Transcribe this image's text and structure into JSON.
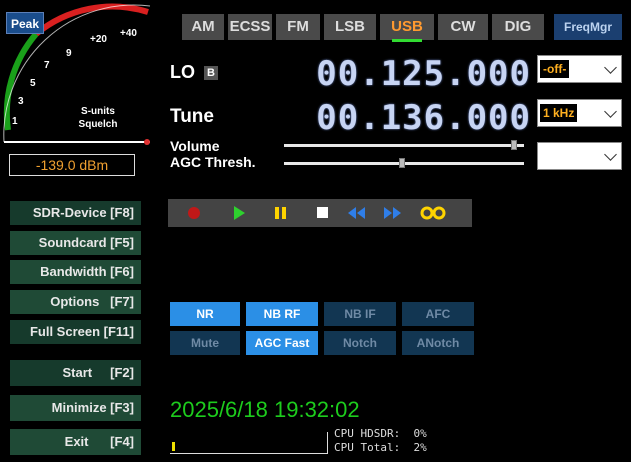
{
  "smeter": {
    "peak_label": "Peak",
    "scale_labels": [
      "1",
      "3",
      "5",
      "7",
      "9",
      "+20",
      "+40"
    ],
    "legend_line1": "S-units",
    "legend_line2": "Squelch",
    "dbm_readout": "-139.0 dBm"
  },
  "modes": [
    {
      "label": "AM",
      "active": false
    },
    {
      "label": "ECSS",
      "active": false
    },
    {
      "label": "FM",
      "active": false
    },
    {
      "label": "LSB",
      "active": false
    },
    {
      "label": "USB",
      "active": true
    },
    {
      "label": "CW",
      "active": false
    },
    {
      "label": "DIG",
      "active": false
    }
  ],
  "freqmgr_label": "FreqMgr",
  "lo": {
    "label": "LO",
    "badge": "B",
    "frequency": "00.125.000",
    "select_value": "-off-"
  },
  "tune": {
    "label": "Tune",
    "frequency": "00.136.000",
    "select_value": "1 kHz"
  },
  "volume": {
    "label": "Volume",
    "level": 0.97
  },
  "agc": {
    "label": "AGC Thresh.",
    "level": 0.49,
    "select_value": ""
  },
  "left_buttons": [
    {
      "label": "SDR-Device [F8]"
    },
    {
      "label": "Soundcard [F5]"
    },
    {
      "label": "Bandwidth [F6]"
    },
    {
      "label": "Options   [F7]"
    },
    {
      "label": "Full Screen [F11]"
    },
    {
      "label": "Start     [F2]"
    },
    {
      "label": "Minimize [F3]"
    },
    {
      "label": "Exit      [F4]"
    }
  ],
  "transport": [
    "record-icon",
    "play-icon",
    "pause-icon",
    "stop-icon",
    "rewind-icon",
    "fast-forward-icon",
    "loop-icon"
  ],
  "dsp_row1": [
    {
      "label": "NR",
      "on": true
    },
    {
      "label": "NB RF",
      "on": true
    },
    {
      "label": "NB IF",
      "on": false
    },
    {
      "label": "AFC",
      "on": false
    }
  ],
  "dsp_row2": [
    {
      "label": "Mute",
      "on": false
    },
    {
      "label": "AGC Fast",
      "on": true
    },
    {
      "label": "Notch",
      "on": false
    },
    {
      "label": "ANotch",
      "on": false
    }
  ],
  "clock": "2025/6/18 19:32:02",
  "cpu": {
    "hdsdr": "CPU HDSDR:  0%",
    "total": "CPU Total:  2%",
    "level": 0.02
  },
  "colors": {
    "accent_green": "#1dcc1d",
    "active_mode": "#ff9a30",
    "dsp_on": "#2b8fe6"
  }
}
